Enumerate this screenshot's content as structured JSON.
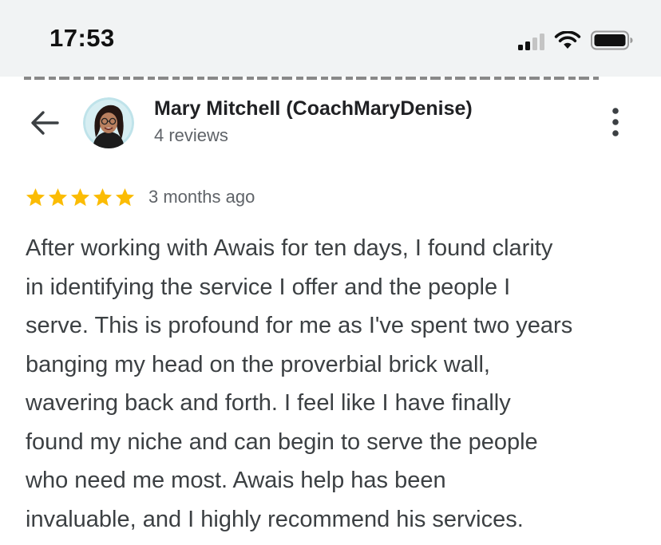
{
  "status_bar": {
    "time": "17:53",
    "icons": [
      "cellular-signal-icon",
      "wifi-icon",
      "battery-icon"
    ]
  },
  "header": {
    "back_icon": "arrow-left-icon",
    "reviewer_name": "Mary Mitchell (CoachMaryDenise)",
    "review_count": "4 reviews",
    "more_icon": "more-vertical-icon"
  },
  "review": {
    "stars": 5,
    "max_stars": 5,
    "date": "3 months ago",
    "lines": [
      "After working with Awais for ten days, I found clarity",
      "in identifying the service I offer and the people I",
      "serve. This is profound for me as I've spent two years",
      "banging my head on the proverbial brick wall,",
      "wavering back and forth. I feel like I have finally",
      "found my niche and can begin to serve the people",
      "who need me most. Awais help has been",
      "invaluable, and I highly recommend his services."
    ]
  },
  "colors": {
    "status_bar_bg": "#f1f3f4",
    "star": "#fbbc04",
    "name_text": "#202124",
    "secondary_text": "#5f6368",
    "body_text": "#3c4043"
  }
}
